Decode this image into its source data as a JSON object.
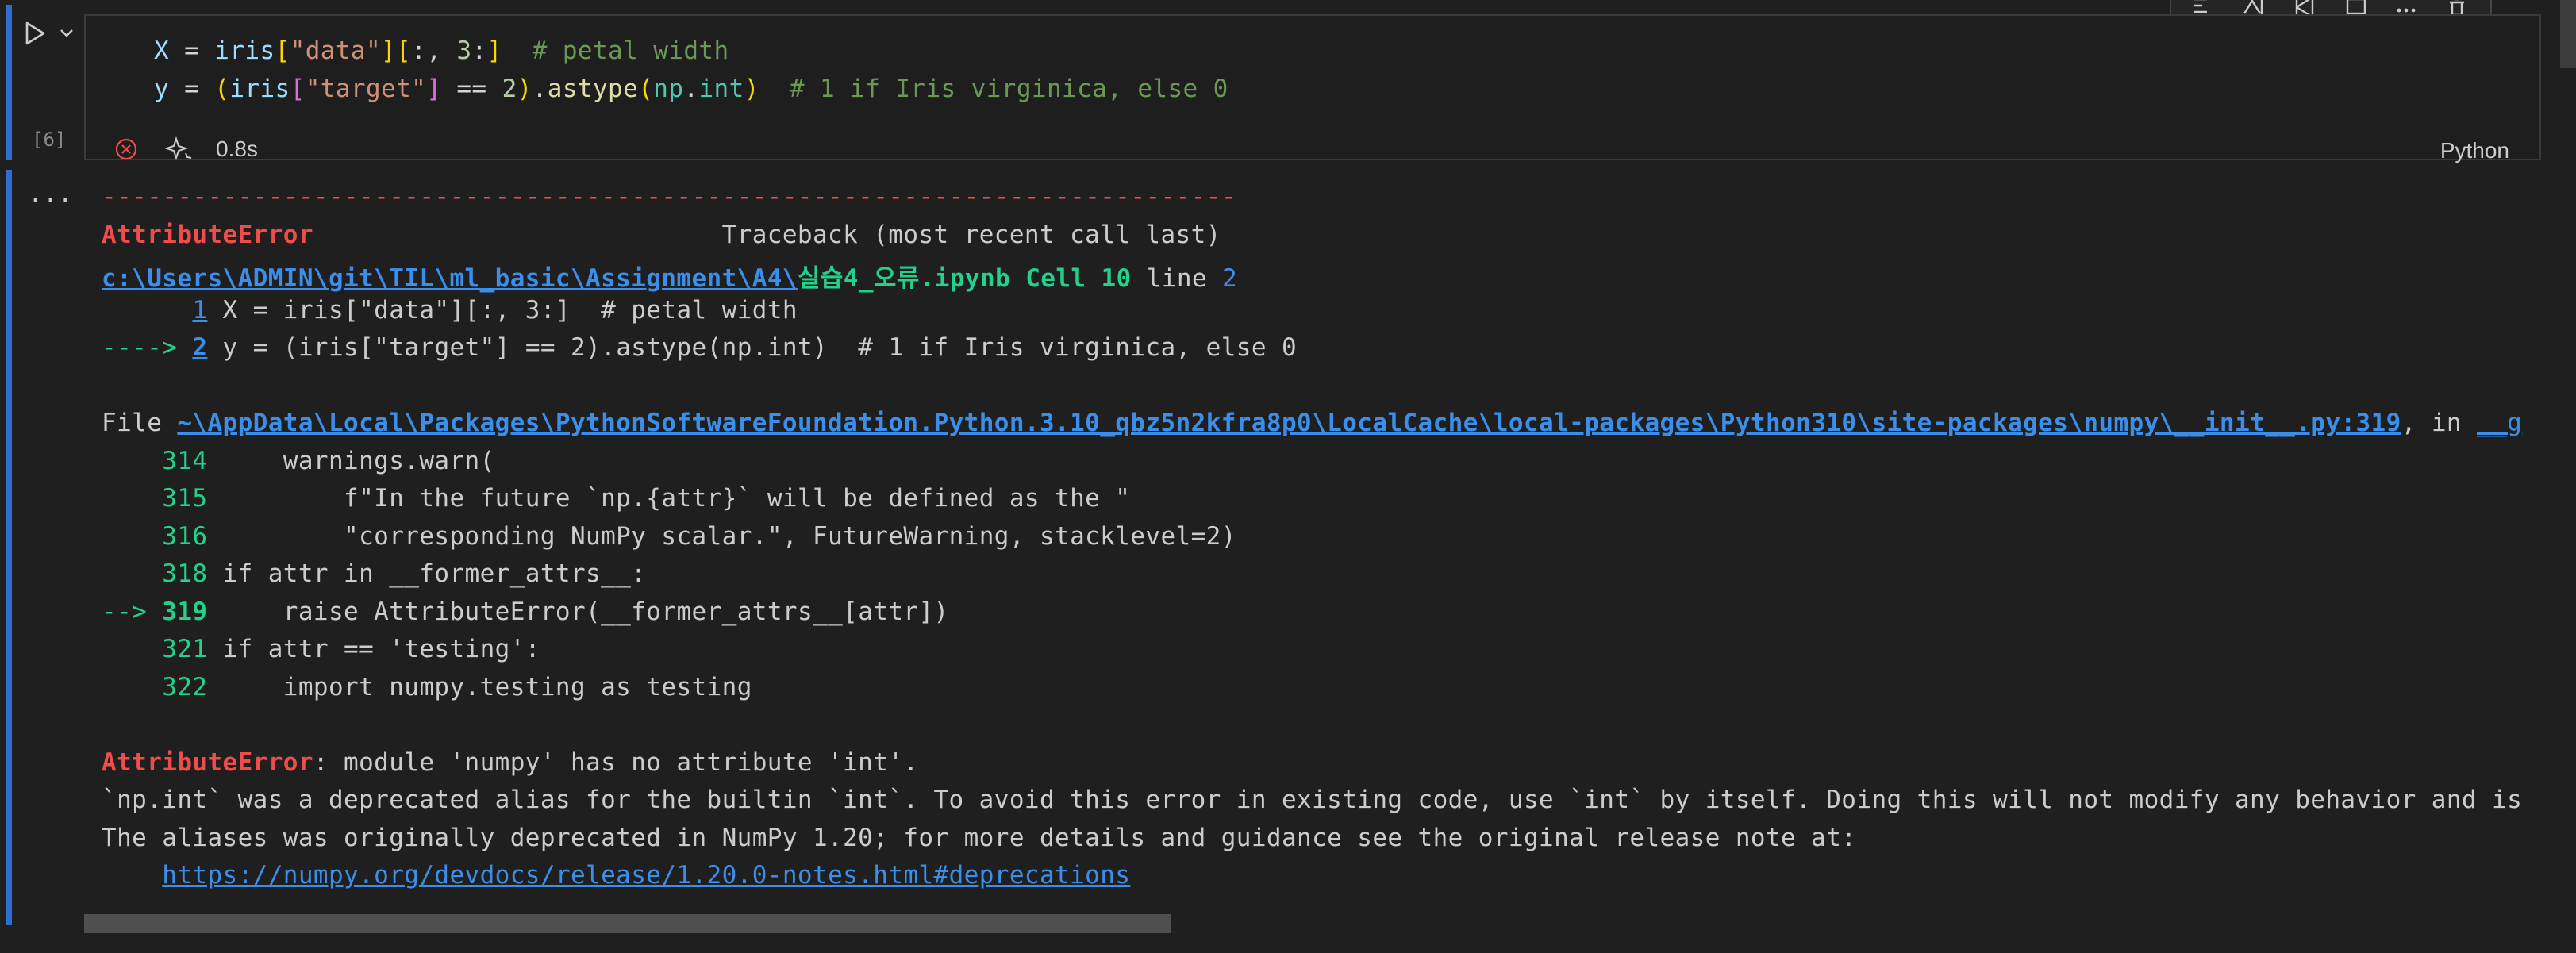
{
  "cell": {
    "execution_count": "[6]",
    "duration": "0.8s",
    "language": "Python",
    "code": {
      "line1": {
        "var": "X",
        "eq": " = ",
        "obj": "iris",
        "b1": "[",
        "s1": "\"data\"",
        "b2": "][",
        "sl": ":, ",
        "n": "3",
        "sl2": ":",
        "b3": "]",
        "sp": "  ",
        "cm": "# petal width"
      },
      "line2": {
        "var": "y",
        "eq": " = ",
        "p1": "(",
        "obj": "iris",
        "b1": "[",
        "s1": "\"target\"",
        "b2": "]",
        "op": " == ",
        "n": "2",
        "p2": ")",
        "dot": ".",
        "fn": "astype",
        "p3": "(",
        "mod": "np",
        "dot2": ".",
        "attr": "int",
        "p4": ")",
        "sp": "  ",
        "cm": "# 1 if Iris virginica, else 0"
      }
    }
  },
  "output": {
    "ellipsis": "...",
    "dashes": "---------------------------------------------------------------------------",
    "err_name": "AttributeError",
    "traceback_header": "                           Traceback (most recent call last)",
    "path_link": "c:\\Users\\ADMIN\\git\\TIL\\ml_basic\\Assignment\\A4\\",
    "file_name": "실습4_오류.ipynb",
    "cell_ref": " Cell 10",
    "line_word": " line ",
    "line_num": "2",
    "ctx1_num": "1",
    "ctx1_code": " X = iris[\"data\"][:, 3:]  # petal width",
    "ctx2_arrow": "---->",
    "ctx2_num": "2",
    "ctx2_code": " y = (iris[\"target\"] == 2).astype(np.int)  # 1 if Iris virginica, else 0",
    "file_label": "File ",
    "file_link": "~\\AppData\\Local\\Packages\\PythonSoftwareFoundation.Python.3.10_qbz5n2kfra8p0\\LocalCache\\local-packages\\Python310\\site-packages\\numpy\\__init__.py:319",
    "file_in": ", in ",
    "file_func": "__g",
    "src": [
      {
        "n": "314",
        "code": "     warnings.warn("
      },
      {
        "n": "315",
        "code": "         f\"In the future `np.{attr}` will be defined as the \""
      },
      {
        "n": "316",
        "code": "         \"corresponding NumPy scalar.\", FutureWarning, stacklevel=2)"
      },
      {
        "n": "318",
        "code": " if attr in __former_attrs__:"
      },
      {
        "n": "319",
        "code": "     raise AttributeError(__former_attrs__[attr])",
        "arrow": "--> "
      },
      {
        "n": "321",
        "code": " if attr == 'testing':"
      },
      {
        "n": "322",
        "code": "     import numpy.testing as testing"
      }
    ],
    "final_err_name": "AttributeError",
    "final_err_msg": ": module 'numpy' has no attribute 'int'.",
    "msg_line1": "`np.int` was a deprecated alias for the builtin `int`. To avoid this error in existing code, use `int` by itself. Doing this will not modify any behavior and is",
    "msg_line2": "The aliases was originally deprecated in NumPy 1.20; for more details and guidance see the original release note at:",
    "release_link": "https://numpy.org/devdocs/release/1.20.0-notes.html#deprecations"
  },
  "colors": {
    "accent_bar": "#2f6fd1",
    "error_red": "#f14c4c",
    "success_green": "#23d18b",
    "link_blue": "#3b8eea"
  },
  "icons": [
    "run-icon",
    "chevron-down-icon",
    "error-circle-icon",
    "sparkle-icon",
    "toolbar-icons"
  ]
}
